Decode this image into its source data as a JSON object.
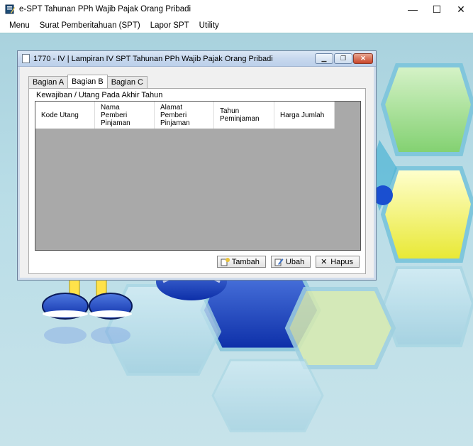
{
  "app": {
    "title": "e-SPT Tahunan PPh Wajib Pajak Orang Pribadi",
    "window_controls": {
      "minimize": "—",
      "maximize": "☐",
      "close": "✕"
    }
  },
  "menubar": {
    "items": [
      {
        "label": "Menu"
      },
      {
        "label": "Surat Pemberitahuan (SPT)"
      },
      {
        "label": "Lapor SPT"
      },
      {
        "label": "Utility"
      }
    ]
  },
  "child_window": {
    "title": "1770 - IV | Lampiran IV SPT Tahunan PPh Wajib Pajak Orang Pribadi",
    "controls": {
      "minimize": "▁",
      "restore": "❐",
      "close": "✕"
    },
    "tabs": [
      {
        "label": "Bagian A",
        "active": false
      },
      {
        "label": "Bagian B",
        "active": true
      },
      {
        "label": "Bagian C",
        "active": false
      }
    ],
    "group_label": "Kewajiban / Utang Pada Akhir Tahun",
    "table": {
      "columns": [
        {
          "label": "Kode Utang"
        },
        {
          "label": "Nama\nPemberi\nPinjaman"
        },
        {
          "label": "Alamat\nPemberi\nPinjaman"
        },
        {
          "label": "Tahun\nPeminjaman"
        },
        {
          "label": "Harga Jumlah"
        }
      ],
      "rows": []
    },
    "buttons": {
      "tambah": "Tambah",
      "ubah": "Ubah",
      "hapus": "Hapus"
    }
  },
  "colors": {
    "background": "#b9dde7",
    "grid_empty": "#a9a9a9"
  }
}
